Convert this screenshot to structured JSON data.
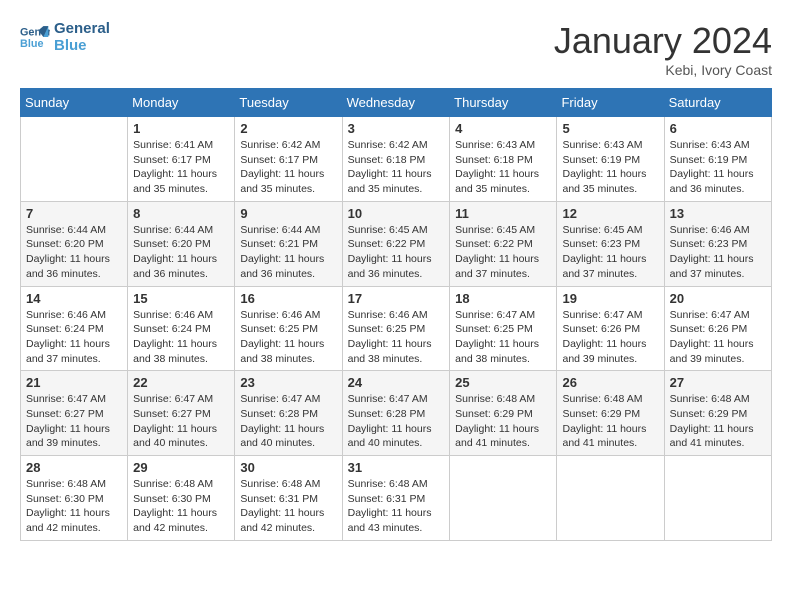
{
  "header": {
    "logo_line1": "General",
    "logo_line2": "Blue",
    "month_title": "January 2024",
    "location": "Kebi, Ivory Coast"
  },
  "weekdays": [
    "Sunday",
    "Monday",
    "Tuesday",
    "Wednesday",
    "Thursday",
    "Friday",
    "Saturday"
  ],
  "weeks": [
    [
      null,
      {
        "day": 1,
        "sunrise": "6:41 AM",
        "sunset": "6:17 PM",
        "daylight": "11 hours and 35 minutes."
      },
      {
        "day": 2,
        "sunrise": "6:42 AM",
        "sunset": "6:17 PM",
        "daylight": "11 hours and 35 minutes."
      },
      {
        "day": 3,
        "sunrise": "6:42 AM",
        "sunset": "6:18 PM",
        "daylight": "11 hours and 35 minutes."
      },
      {
        "day": 4,
        "sunrise": "6:43 AM",
        "sunset": "6:18 PM",
        "daylight": "11 hours and 35 minutes."
      },
      {
        "day": 5,
        "sunrise": "6:43 AM",
        "sunset": "6:19 PM",
        "daylight": "11 hours and 35 minutes."
      },
      {
        "day": 6,
        "sunrise": "6:43 AM",
        "sunset": "6:19 PM",
        "daylight": "11 hours and 36 minutes."
      }
    ],
    [
      {
        "day": 7,
        "sunrise": "6:44 AM",
        "sunset": "6:20 PM",
        "daylight": "11 hours and 36 minutes."
      },
      {
        "day": 8,
        "sunrise": "6:44 AM",
        "sunset": "6:20 PM",
        "daylight": "11 hours and 36 minutes."
      },
      {
        "day": 9,
        "sunrise": "6:44 AM",
        "sunset": "6:21 PM",
        "daylight": "11 hours and 36 minutes."
      },
      {
        "day": 10,
        "sunrise": "6:45 AM",
        "sunset": "6:22 PM",
        "daylight": "11 hours and 36 minutes."
      },
      {
        "day": 11,
        "sunrise": "6:45 AM",
        "sunset": "6:22 PM",
        "daylight": "11 hours and 37 minutes."
      },
      {
        "day": 12,
        "sunrise": "6:45 AM",
        "sunset": "6:23 PM",
        "daylight": "11 hours and 37 minutes."
      },
      {
        "day": 13,
        "sunrise": "6:46 AM",
        "sunset": "6:23 PM",
        "daylight": "11 hours and 37 minutes."
      }
    ],
    [
      {
        "day": 14,
        "sunrise": "6:46 AM",
        "sunset": "6:24 PM",
        "daylight": "11 hours and 37 minutes."
      },
      {
        "day": 15,
        "sunrise": "6:46 AM",
        "sunset": "6:24 PM",
        "daylight": "11 hours and 38 minutes."
      },
      {
        "day": 16,
        "sunrise": "6:46 AM",
        "sunset": "6:25 PM",
        "daylight": "11 hours and 38 minutes."
      },
      {
        "day": 17,
        "sunrise": "6:46 AM",
        "sunset": "6:25 PM",
        "daylight": "11 hours and 38 minutes."
      },
      {
        "day": 18,
        "sunrise": "6:47 AM",
        "sunset": "6:25 PM",
        "daylight": "11 hours and 38 minutes."
      },
      {
        "day": 19,
        "sunrise": "6:47 AM",
        "sunset": "6:26 PM",
        "daylight": "11 hours and 39 minutes."
      },
      {
        "day": 20,
        "sunrise": "6:47 AM",
        "sunset": "6:26 PM",
        "daylight": "11 hours and 39 minutes."
      }
    ],
    [
      {
        "day": 21,
        "sunrise": "6:47 AM",
        "sunset": "6:27 PM",
        "daylight": "11 hours and 39 minutes."
      },
      {
        "day": 22,
        "sunrise": "6:47 AM",
        "sunset": "6:27 PM",
        "daylight": "11 hours and 40 minutes."
      },
      {
        "day": 23,
        "sunrise": "6:47 AM",
        "sunset": "6:28 PM",
        "daylight": "11 hours and 40 minutes."
      },
      {
        "day": 24,
        "sunrise": "6:47 AM",
        "sunset": "6:28 PM",
        "daylight": "11 hours and 40 minutes."
      },
      {
        "day": 25,
        "sunrise": "6:48 AM",
        "sunset": "6:29 PM",
        "daylight": "11 hours and 41 minutes."
      },
      {
        "day": 26,
        "sunrise": "6:48 AM",
        "sunset": "6:29 PM",
        "daylight": "11 hours and 41 minutes."
      },
      {
        "day": 27,
        "sunrise": "6:48 AM",
        "sunset": "6:29 PM",
        "daylight": "11 hours and 41 minutes."
      }
    ],
    [
      {
        "day": 28,
        "sunrise": "6:48 AM",
        "sunset": "6:30 PM",
        "daylight": "11 hours and 42 minutes."
      },
      {
        "day": 29,
        "sunrise": "6:48 AM",
        "sunset": "6:30 PM",
        "daylight": "11 hours and 42 minutes."
      },
      {
        "day": 30,
        "sunrise": "6:48 AM",
        "sunset": "6:31 PM",
        "daylight": "11 hours and 42 minutes."
      },
      {
        "day": 31,
        "sunrise": "6:48 AM",
        "sunset": "6:31 PM",
        "daylight": "11 hours and 43 minutes."
      },
      null,
      null,
      null
    ]
  ],
  "labels": {
    "sunrise": "Sunrise:",
    "sunset": "Sunset:",
    "daylight": "Daylight:"
  }
}
